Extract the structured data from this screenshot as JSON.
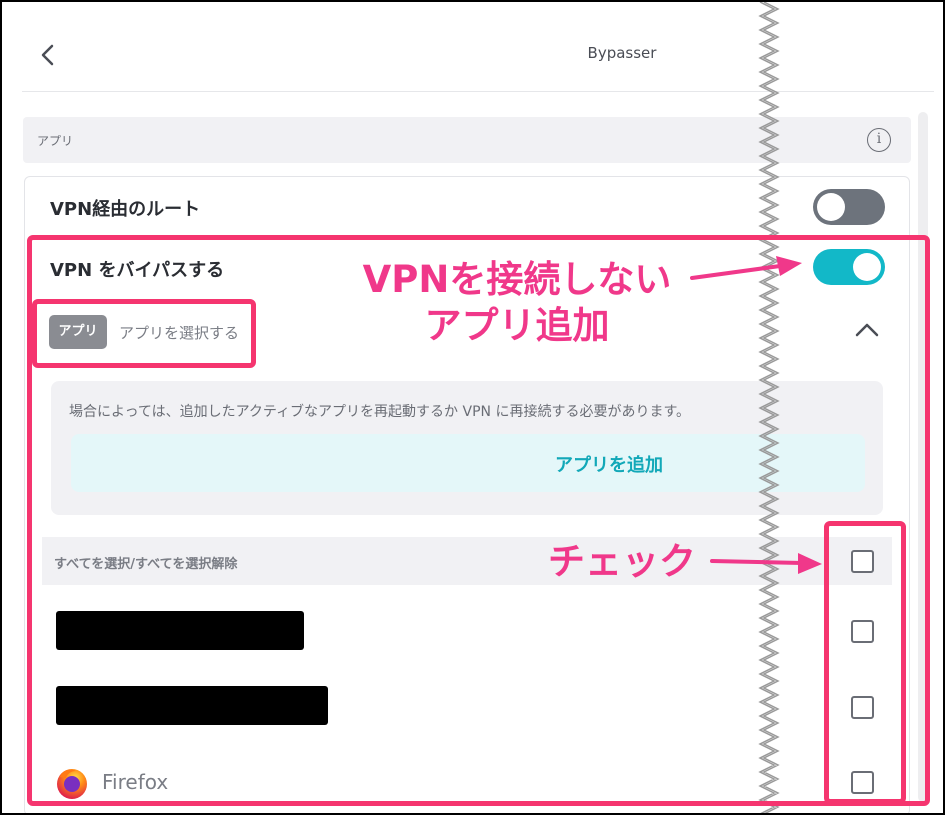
{
  "header": {
    "back_icon": "chevron-left-icon",
    "title": "Bypasser"
  },
  "section": {
    "label": "アプリ",
    "info_glyph": "i"
  },
  "settings": {
    "route_via_vpn_label": "VPN経由のルート",
    "route_via_vpn_on": false,
    "bypass_vpn_label": "VPN をバイパスする",
    "bypass_vpn_on": true,
    "toggle_on_color": "#12b8c8",
    "toggle_off_color": "#6d737c"
  },
  "apps_selector": {
    "chip_label": "アプリ",
    "placeholder": "アプリを選択する",
    "info_text": "場合によっては、追加したアクティブなアプリを再起動するか VPN に再接続する必要があります。",
    "add_button_label": "アプリを追加"
  },
  "app_list": {
    "select_all_label": "すべてを選択/すべてを選択解除",
    "items": [
      {
        "name": "",
        "redacted": true,
        "checked": false
      },
      {
        "name": "",
        "redacted": true,
        "checked": false
      },
      {
        "name": "Firefox",
        "icon": "firefox-icon",
        "checked": false
      }
    ]
  },
  "annotations": {
    "callout_1_line1": "VPNを接続しない",
    "callout_1_line2": "アプリ追加",
    "callout_2": "チェック",
    "highlight_color": "#f5356f",
    "text_color": "#f0388a"
  }
}
